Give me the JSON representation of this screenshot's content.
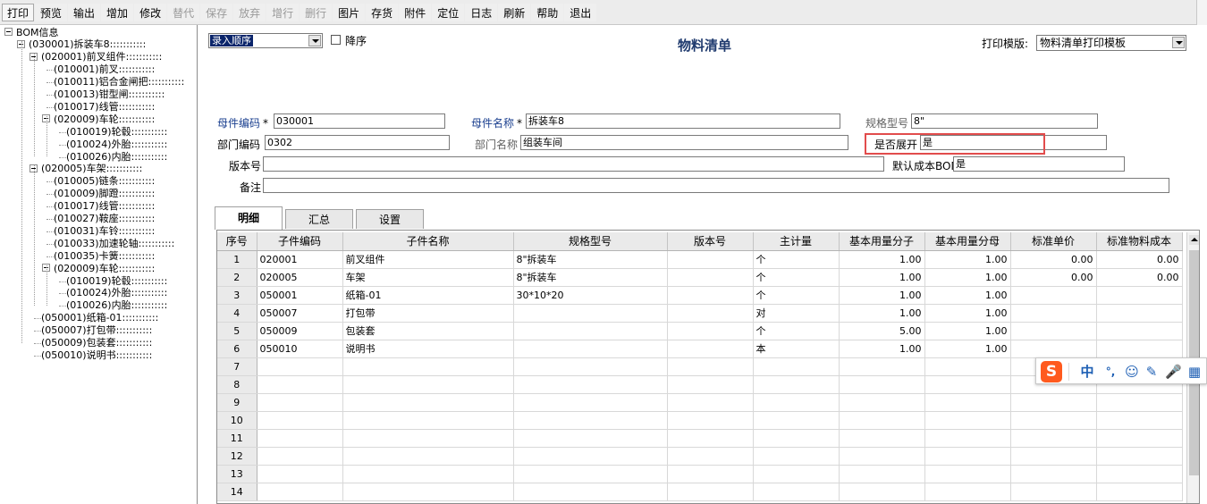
{
  "toolbar": {
    "buttons": [
      {
        "label": "打印",
        "enabled": true
      },
      {
        "label": "预览",
        "enabled": true
      },
      {
        "label": "输出",
        "enabled": true
      },
      {
        "label": "增加",
        "enabled": true
      },
      {
        "label": "修改",
        "enabled": true
      },
      {
        "label": "替代",
        "enabled": false
      },
      {
        "label": "保存",
        "enabled": false
      },
      {
        "label": "放弃",
        "enabled": false
      },
      {
        "label": "增行",
        "enabled": false
      },
      {
        "label": "删行",
        "enabled": false
      },
      {
        "label": "图片",
        "enabled": true
      },
      {
        "label": "存货",
        "enabled": true
      },
      {
        "label": "附件",
        "enabled": true
      },
      {
        "label": "定位",
        "enabled": true
      },
      {
        "label": "日志",
        "enabled": true
      },
      {
        "label": "刷新",
        "enabled": true
      },
      {
        "label": "帮助",
        "enabled": true
      },
      {
        "label": "退出",
        "enabled": true
      }
    ]
  },
  "tree": {
    "root": "BOM信息",
    "items": [
      "(030001)拆装车8:::::::::::",
      "(020001)前叉组件:::::::::::",
      "(010001)前叉:::::::::::",
      "(010011)铝合金闸把:::::::::::",
      "(010013)钳型闸:::::::::::",
      "(010017)线管:::::::::::",
      "(020009)车轮:::::::::::",
      "(010019)轮毂:::::::::::",
      "(010024)外胎:::::::::::",
      "(010026)内胎:::::::::::",
      "(020005)车架:::::::::::",
      "(010005)链条:::::::::::",
      "(010009)脚蹬:::::::::::",
      "(010017)线管:::::::::::",
      "(010027)鞍座:::::::::::",
      "(010031)车铃:::::::::::",
      "(010033)加速轮轴:::::::::::",
      "(010035)卡簧:::::::::::",
      "(020009)车轮:::::::::::",
      "(010019)轮毂:::::::::::",
      "(010024)外胎:::::::::::",
      "(010026)内胎:::::::::::",
      "(050001)纸箱-01:::::::::::",
      "(050007)打包带:::::::::::",
      "(050009)包装套:::::::::::",
      "(050010)说明书:::::::::::"
    ]
  },
  "header": {
    "sort_value": "录入顺序",
    "desc_label": "降序",
    "title": "物料清单",
    "print_template_label": "打印模版:",
    "print_template_value": "物料清单打印模板"
  },
  "form": {
    "parent_code_label": "母件编码",
    "parent_code": "030001",
    "parent_name_label": "母件名称",
    "parent_name": "拆装车8",
    "spec_label": "规格型号",
    "spec": "8\"",
    "dept_code_label": "部门编码",
    "dept_code": "0302",
    "dept_name_label": "部门名称",
    "dept_name": "组装车间",
    "expand_label": "是否展开",
    "expand": "是",
    "version_label": "版本号",
    "version": "",
    "default_cost_label": "默认成本BOM",
    "default_cost": "是",
    "note_label": "备注",
    "note": "",
    "required_mark": "*"
  },
  "tabs": [
    "明细",
    "汇总",
    "设置"
  ],
  "grid": {
    "columns": [
      "序号",
      "子件编码",
      "子件名称",
      "规格型号",
      "版本号",
      "主计量",
      "基本用量分子",
      "基本用量分母",
      "标准单价",
      "标准物料成本"
    ],
    "rows": [
      [
        "1",
        "020001",
        "前叉组件",
        "8\"拆装车",
        "",
        "个",
        "1.00",
        "1.00",
        "0.00",
        "0.00"
      ],
      [
        "2",
        "020005",
        "车架",
        "8\"拆装车",
        "",
        "个",
        "1.00",
        "1.00",
        "0.00",
        "0.00"
      ],
      [
        "3",
        "050001",
        "纸箱-01",
        "30*10*20",
        "",
        "个",
        "1.00",
        "1.00",
        "",
        ""
      ],
      [
        "4",
        "050007",
        "打包带",
        "",
        "",
        "对",
        "1.00",
        "1.00",
        "",
        ""
      ],
      [
        "5",
        "050009",
        "包装套",
        "",
        "",
        "个",
        "5.00",
        "1.00",
        "",
        ""
      ],
      [
        "6",
        "050010",
        "说明书",
        "",
        "",
        "本",
        "1.00",
        "1.00",
        "",
        ""
      ],
      [
        "7",
        "",
        "",
        "",
        "",
        "",
        "",
        "",
        "",
        ""
      ],
      [
        "8",
        "",
        "",
        "",
        "",
        "",
        "",
        "",
        "",
        ""
      ],
      [
        "9",
        "",
        "",
        "",
        "",
        "",
        "",
        "",
        "",
        ""
      ],
      [
        "10",
        "",
        "",
        "",
        "",
        "",
        "",
        "",
        "",
        ""
      ],
      [
        "11",
        "",
        "",
        "",
        "",
        "",
        "",
        "",
        "",
        ""
      ],
      [
        "12",
        "",
        "",
        "",
        "",
        "",
        "",
        "",
        "",
        ""
      ],
      [
        "13",
        "",
        "",
        "",
        "",
        "",
        "",
        "",
        "",
        ""
      ],
      [
        "14",
        "",
        "",
        "",
        "",
        "",
        "",
        "",
        "",
        ""
      ]
    ]
  },
  "ime": {
    "logo": "S",
    "items": [
      "中",
      "°,",
      "☺",
      "✎",
      "🎤",
      "▦"
    ],
    "icon_names": [
      "chinese-mode-icon",
      "punctuation-icon",
      "emoji-icon",
      "pen-icon",
      "microphone-icon",
      "toolbox-icon"
    ]
  },
  "colors": {
    "accent_blue": "#1a3f8f",
    "title_blue": "#1f3a6e",
    "highlight_red": "#e24c4c",
    "ime_orange": "#ff5a1e"
  }
}
